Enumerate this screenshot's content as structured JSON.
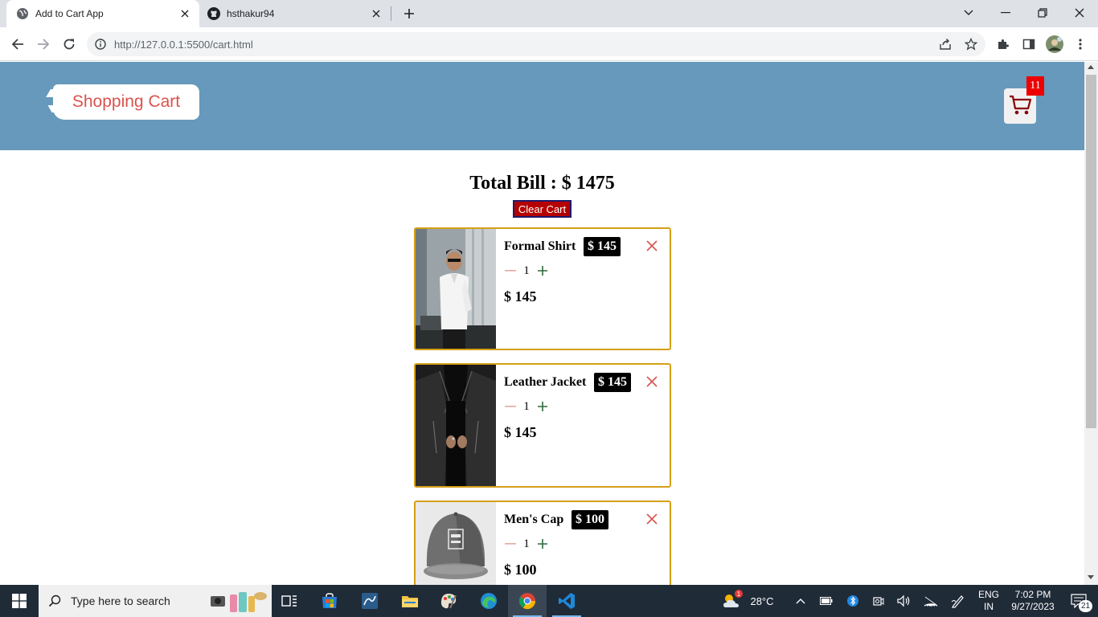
{
  "browser": {
    "tabs": [
      {
        "title": "Add to Cart App",
        "active": true
      },
      {
        "title": "hsthakur94",
        "active": false
      }
    ],
    "url": "http://127.0.0.1:5500/cart.html"
  },
  "header": {
    "brand": "Shopping Cart",
    "cart_count": "11"
  },
  "summary": {
    "total_label": "Total Bill : $ 1475",
    "clear_label": "Clear Cart"
  },
  "cart_items": [
    {
      "name": "Formal Shirt",
      "price": "$ 145",
      "qty": "1",
      "subtotal": "$ 145",
      "image": "man-in-white-shirt"
    },
    {
      "name": "Leather Jacket",
      "price": "$ 145",
      "qty": "1",
      "subtotal": "$ 145",
      "image": "black-leather-jacket"
    },
    {
      "name": "Men's Cap",
      "price": "$ 100",
      "qty": "1",
      "subtotal": "$ 100",
      "image": "grey-cap"
    }
  ],
  "taskbar": {
    "search_placeholder": "Type here to search",
    "weather": "28°C",
    "weather_badge": "1",
    "lang_top": "ENG",
    "lang_bottom": "IN",
    "time": "7:02 PM",
    "date": "9/27/2023",
    "notification_count": "21"
  },
  "colors": {
    "header_bg": "#6699bb",
    "brand_text": "#d9534f",
    "card_border": "#d4a017",
    "clear_bg": "#b40000",
    "badge_bg": "#ee0000"
  }
}
